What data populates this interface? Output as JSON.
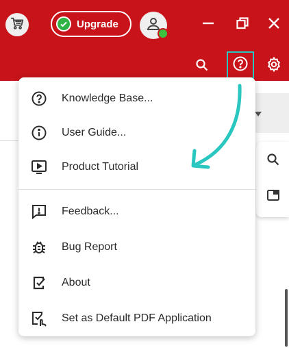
{
  "titlebar": {
    "upgrade_label": "Upgrade",
    "icons": [
      "cart-icon",
      "check-icon",
      "user-icon",
      "minimize-icon",
      "restore-icon",
      "close-icon"
    ]
  },
  "toolbar": {
    "icons": [
      "search-icon",
      "help-icon",
      "settings-icon"
    ]
  },
  "help_menu": {
    "items": [
      {
        "label": "Knowledge Base...",
        "icon": "question-circle-icon"
      },
      {
        "label": "User Guide...",
        "icon": "info-circle-icon"
      },
      {
        "label": "Product Tutorial",
        "icon": "video-play-icon"
      },
      {
        "label": "Feedback...",
        "icon": "feedback-icon"
      },
      {
        "label": "Bug Report",
        "icon": "bug-icon"
      },
      {
        "label": "About",
        "icon": "about-icon"
      },
      {
        "label": "Set as Default PDF Application",
        "icon": "default-app-icon"
      }
    ]
  },
  "colors": {
    "brand_red": "#c8131a",
    "highlight_teal": "#2ac7c0",
    "status_green": "#2fb344"
  }
}
